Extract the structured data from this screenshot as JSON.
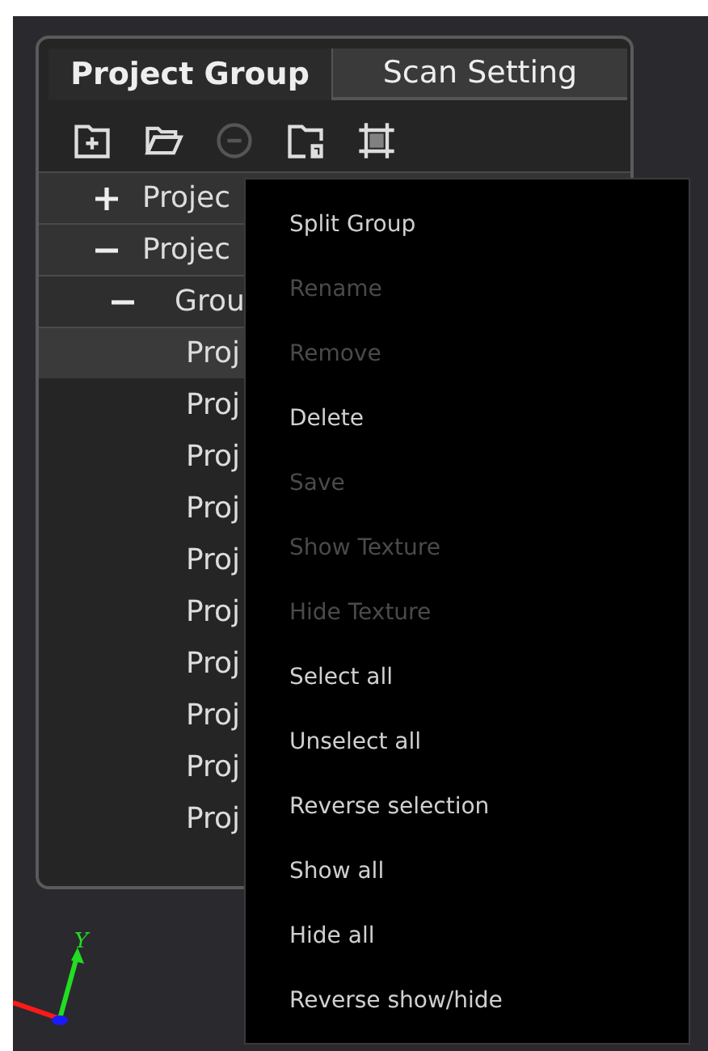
{
  "tabs": [
    {
      "label": "Project Group",
      "selected": true
    },
    {
      "label": "Scan Setting",
      "selected": false
    }
  ],
  "toolbar": [
    {
      "kind": "add-folder",
      "disabled": false
    },
    {
      "kind": "open-folder",
      "disabled": false
    },
    {
      "kind": "remove",
      "disabled": true
    },
    {
      "kind": "delete-folder",
      "disabled": false
    },
    {
      "kind": "frame",
      "disabled": false
    }
  ],
  "tree": [
    {
      "label": "Projec",
      "expanded": false
    },
    {
      "label": "Projec",
      "expanded": true,
      "children": [
        {
          "label": "Grou",
          "expanded": true,
          "children": [
            {
              "label": "Proj",
              "selected": true
            },
            {
              "label": "Proj",
              "selected": false
            },
            {
              "label": "Proj",
              "selected": false
            },
            {
              "label": "Proj",
              "selected": false
            },
            {
              "label": "Proj",
              "selected": false
            },
            {
              "label": "Proj",
              "selected": false
            },
            {
              "label": "Proj",
              "selected": false
            },
            {
              "label": "Proj",
              "selected": false
            },
            {
              "label": "Proj",
              "selected": false
            },
            {
              "label": "Proj",
              "selected": false
            }
          ]
        }
      ]
    }
  ],
  "context_menu": [
    {
      "label": "Split Group",
      "disabled": false
    },
    {
      "label": "Rename",
      "disabled": true
    },
    {
      "label": "Remove",
      "disabled": true
    },
    {
      "label": "Delete",
      "disabled": false
    },
    {
      "label": "Save",
      "disabled": true
    },
    {
      "label": "Show Texture",
      "disabled": true
    },
    {
      "label": "Hide Texture",
      "disabled": true
    },
    {
      "label": "Select all",
      "disabled": false
    },
    {
      "label": "Unselect all",
      "disabled": false
    },
    {
      "label": "Reverse selection",
      "disabled": false
    },
    {
      "label": "Show all",
      "disabled": false
    },
    {
      "label": "Hide all",
      "disabled": false
    },
    {
      "label": "Reverse show/hide",
      "disabled": false
    }
  ],
  "axis_label": "Y"
}
